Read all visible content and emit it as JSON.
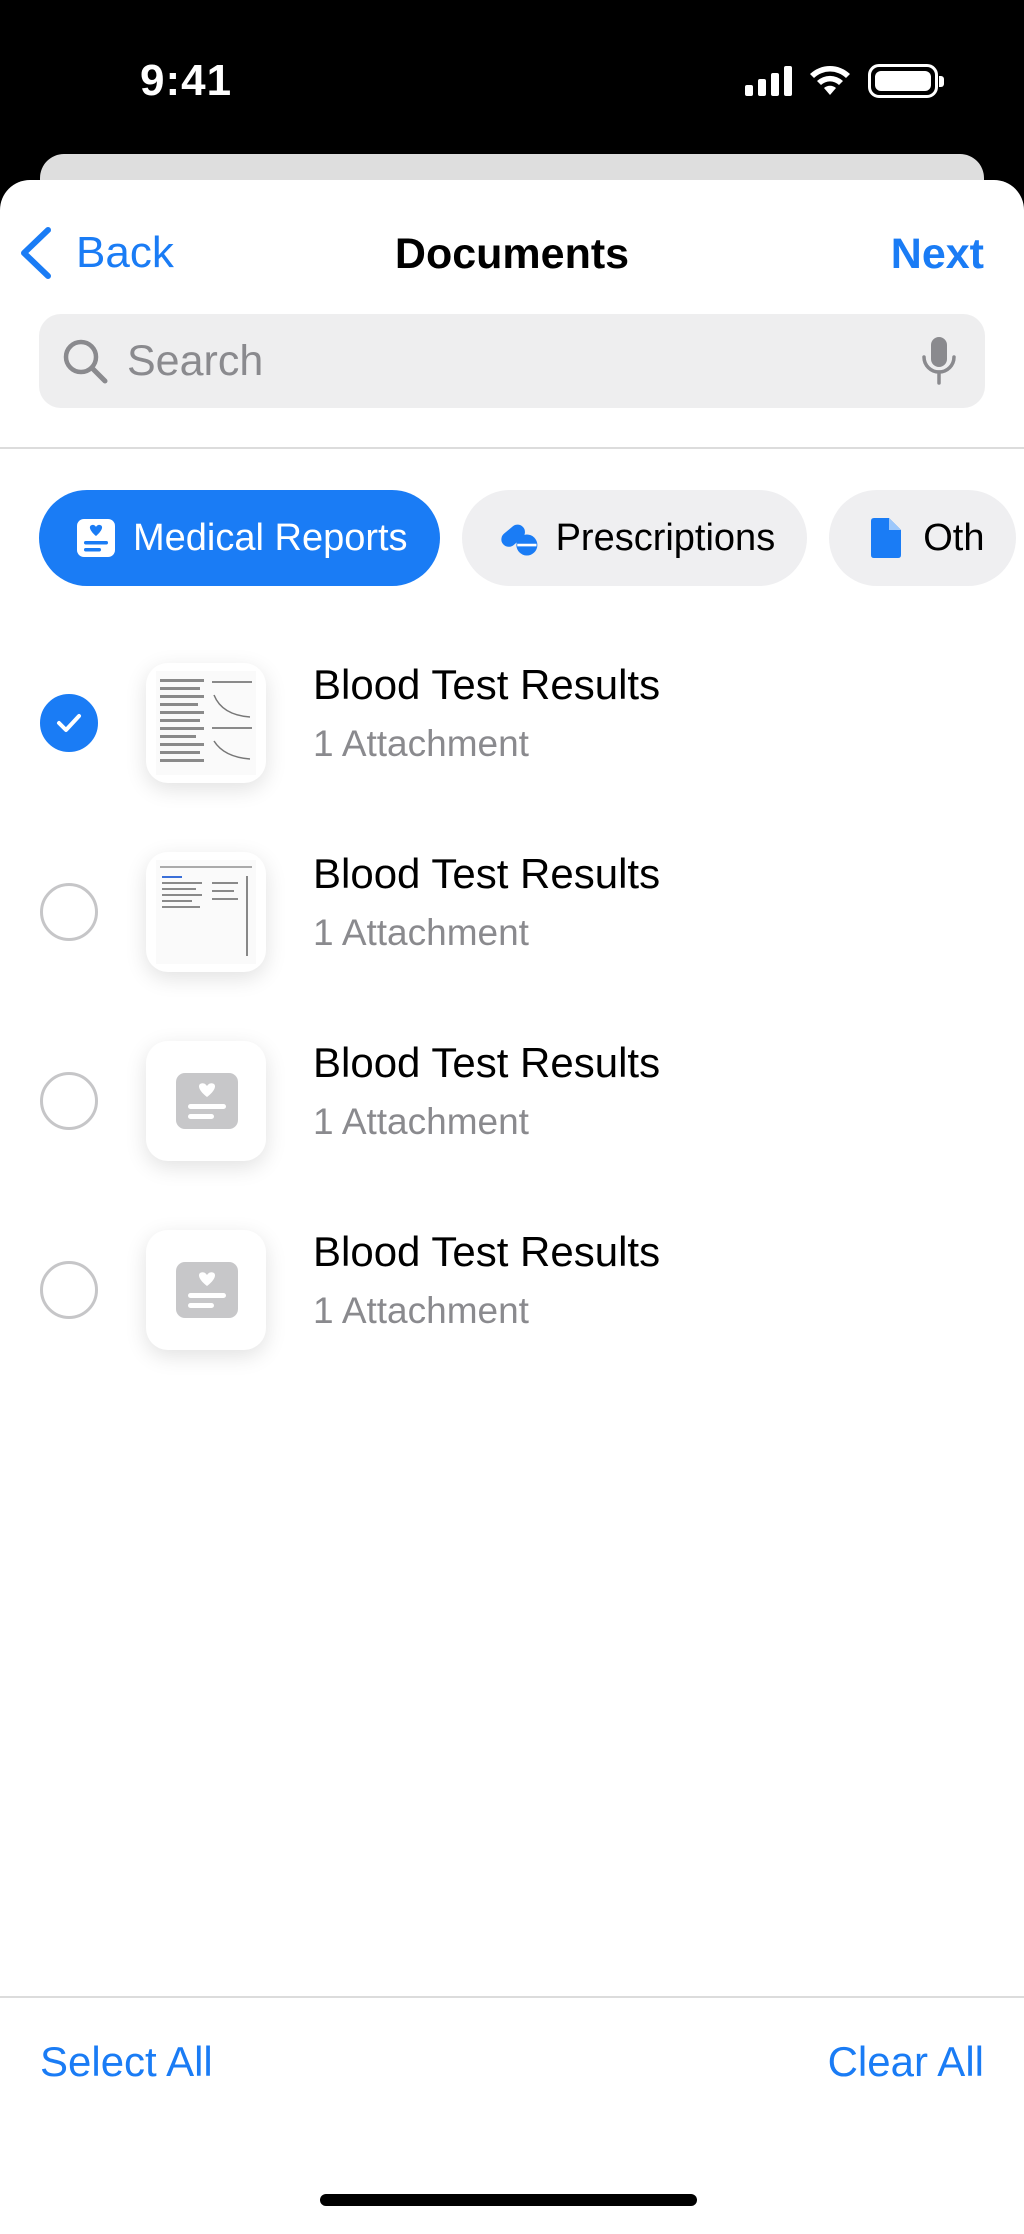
{
  "status_bar": {
    "time": "9:41",
    "signal_icon": "cellular-signal-icon",
    "wifi_icon": "wifi-icon",
    "battery_icon": "battery-icon"
  },
  "nav": {
    "back_label": "Back",
    "title": "Documents",
    "next_label": "Next"
  },
  "search": {
    "placeholder": "Search"
  },
  "accent_color": "#1a7cf5",
  "categories": [
    {
      "label": "Medical Reports",
      "icon": "medical-report-icon",
      "selected": true
    },
    {
      "label": "Prescriptions",
      "icon": "pills-icon",
      "selected": false
    },
    {
      "label": "Oth",
      "icon": "document-icon",
      "selected": false
    }
  ],
  "documents": [
    {
      "title": "Blood Test Results",
      "subtitle": "1 Attachment",
      "checked": true,
      "thumbnail": "document-preview"
    },
    {
      "title": "Blood Test Results",
      "subtitle": "1 Attachment",
      "checked": false,
      "thumbnail": "document-preview"
    },
    {
      "title": "Blood Test Results",
      "subtitle": "1 Attachment",
      "checked": false,
      "thumbnail": "medical-report-icon"
    },
    {
      "title": "Blood Test Results",
      "subtitle": "1 Attachment",
      "checked": false,
      "thumbnail": "medical-report-icon"
    }
  ],
  "footer": {
    "select_all_label": "Select All",
    "clear_all_label": "Clear All"
  }
}
